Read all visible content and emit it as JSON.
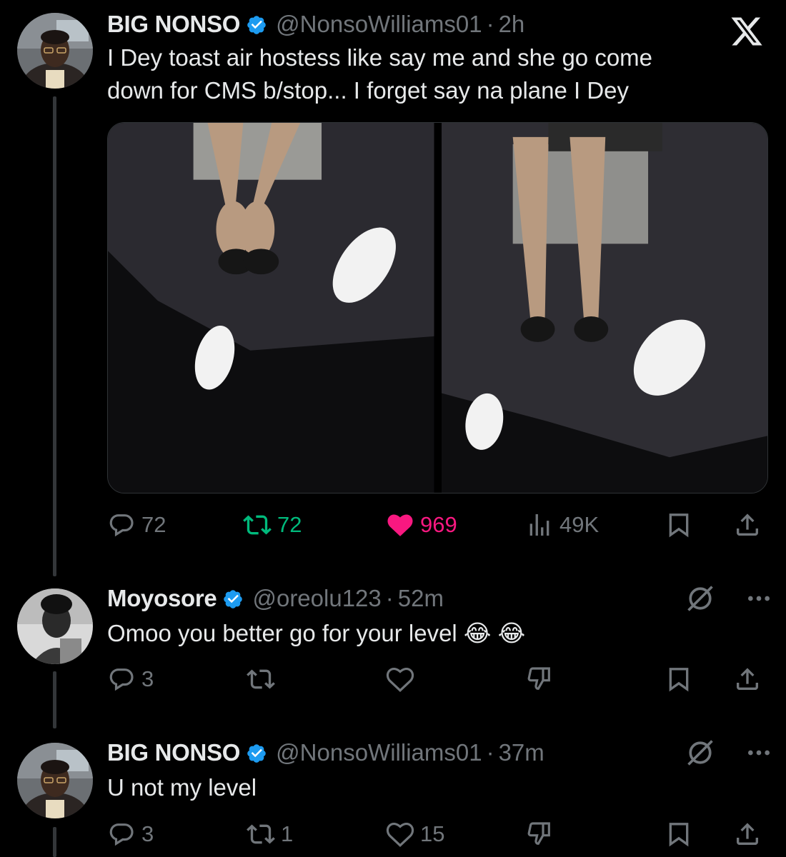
{
  "main_tweet": {
    "display_name": "BIG NONSO",
    "handle": "@NonsoWilliams01",
    "separator": "·",
    "time": "2h",
    "text_line1": "I Dey toast air hostess like say me and she go come",
    "text_line2": "down for CMS b/stop... I forget say na plane I Dey",
    "replies": "72",
    "reposts": "72",
    "likes": "969",
    "views": "49K",
    "liked": true,
    "reposted": true
  },
  "replies": [
    {
      "display_name": "Moyosore",
      "handle": "@oreolu123",
      "separator": "·",
      "time": "52m",
      "text": "Omoo you better go for your level 😂 😂",
      "replies": "3",
      "reposts": "",
      "likes": ""
    },
    {
      "display_name": "BIG NONSO",
      "handle": "@NonsoWilliams01",
      "separator": "·",
      "time": "37m",
      "text": "U not my level",
      "replies": "3",
      "reposts": "1",
      "likes": "15"
    }
  ],
  "icons": {
    "brand": "x-logo-icon",
    "verified": "verified-badge-icon",
    "reply": "reply-icon",
    "repost": "repost-icon",
    "like": "heart-icon",
    "views": "views-chart-icon",
    "bookmark": "bookmark-icon",
    "share": "share-icon",
    "dislike": "downvote-icon",
    "grok": "grok-icon",
    "more": "more-dots-icon"
  },
  "colors": {
    "background": "#000000",
    "text": "#e7e9ea",
    "secondary": "#71767b",
    "verified": "#1d9bf0",
    "repost_active": "#00ba7c",
    "like_active": "#f91880",
    "thread_line": "#333639"
  }
}
